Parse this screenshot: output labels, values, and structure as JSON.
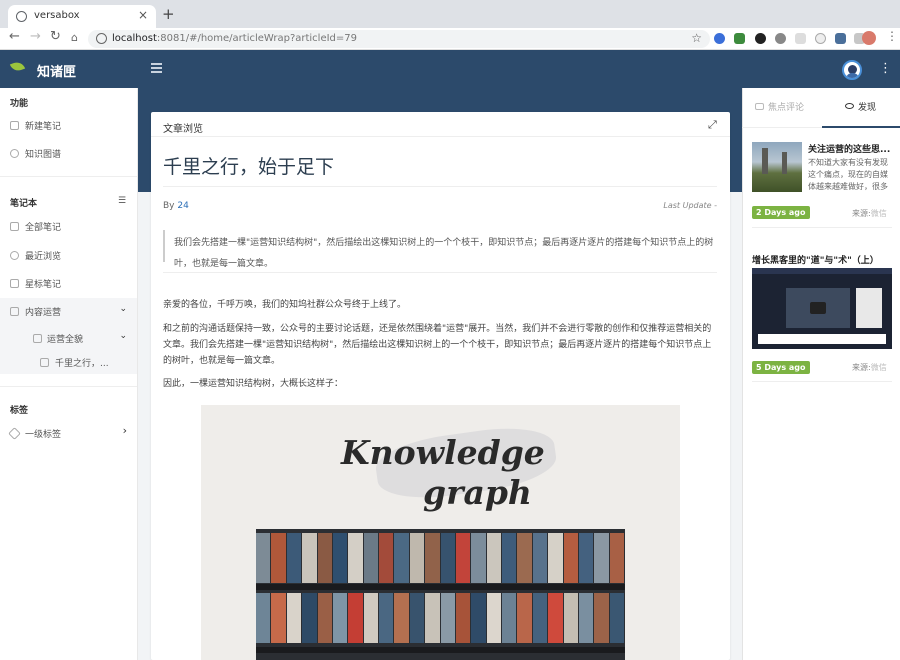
{
  "browser": {
    "tab_title": "versabox",
    "tab_close": "×",
    "new_tab": "+",
    "url_host": "localhost",
    "url_rest": ":8081/#/home/articleWrap?articleId=79",
    "back": "←",
    "forward": "→",
    "reload": "↻",
    "star": "☆",
    "menu": "⋮"
  },
  "header": {
    "brand": "知诸匣",
    "more": "⋮"
  },
  "sidebar": {
    "section_functions": "功能",
    "functions": [
      {
        "label": "新建笔记",
        "icon": "edit-icon"
      },
      {
        "label": "知识图谱",
        "icon": "graph-icon"
      }
    ],
    "section_notebooks": "笔记本",
    "notebooks": [
      {
        "label": "全部笔记",
        "icon": "book-icon"
      },
      {
        "label": "最近浏览",
        "icon": "clock-icon"
      },
      {
        "label": "星标笔记",
        "icon": "star-icon"
      },
      {
        "label": "内容运营",
        "icon": "folder-icon",
        "expanded": true
      },
      {
        "label": "运营全貌",
        "icon": "folder-icon",
        "expanded": true
      },
      {
        "label": "千里之行，...",
        "icon": "note-icon",
        "active": true
      }
    ],
    "section_tags": "标签",
    "tags": [
      {
        "label": "一级标签",
        "icon": "tag-icon"
      }
    ],
    "chevron_down": "⌄",
    "chevron_right": "›"
  },
  "article": {
    "panel_title": "文章浏览",
    "expand": "⤢",
    "title": "千里之行，始于足下",
    "by_prefix": "By",
    "author": "24",
    "last_update": "Last Update -",
    "quote": "我们会先搭建一棵\"运营知识结构树\"，然后描绘出这棵知识树上的一个个枝干，即知识节点；最后再逐片逐片的搭建每个知识节点上的树叶，也就是每一篇文章。",
    "paragraphs": [
      "亲爱的各位，千呼万唤，我们的知坞社群公众号终于上线了。",
      "和之前的沟通话题保持一致，公众号的主要讨论话题，还是依然围绕着\"运营\"展开。当然，我们并不会进行零散的创作和仅推荐运营相关的文章。我们会先搭建一棵\"运营知识结构树\"，然后描绘出这棵知识树上的一个个枝干，即知识节点；最后再逐片逐片的搭建每个知识节点上的树叶，也就是每一篇文章。",
      "因此，一棵运营知识结构树，大概长这样子："
    ],
    "image_text_1": "Knowledge",
    "image_text_2": "graph"
  },
  "right_panel": {
    "tab_comments": "焦点评论",
    "tab_discover": "发现",
    "news": [
      {
        "title": "关注运营的这些思...",
        "desc": "不知道大家有没有发现这个痛点，现在的自媒体越来越难做好，很多",
        "badge": "2 Days ago",
        "source_label": "来源:",
        "source": "微信"
      },
      {
        "title": "增长黑客里的\"道\"与\"术\"（上）",
        "badge": "5 Days ago",
        "source_label": "来源:",
        "source": "微信"
      }
    ]
  },
  "colors": {
    "header": "#2c4a6b",
    "badge": "#7cb342",
    "link": "#2c6fb7"
  }
}
